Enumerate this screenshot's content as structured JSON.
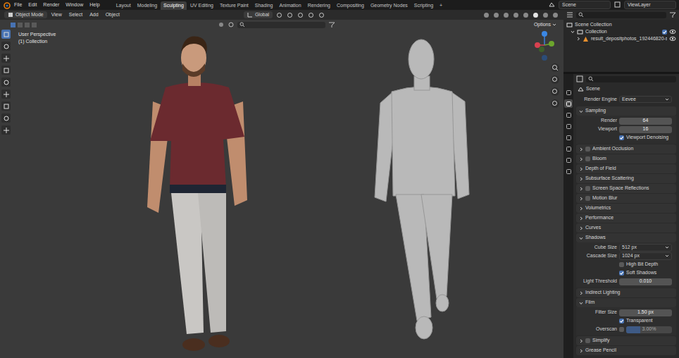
{
  "topbar": {
    "menus": [
      "File",
      "Edit",
      "Render",
      "Window",
      "Help"
    ],
    "workspaces": [
      {
        "label": "Layout",
        "selected": false
      },
      {
        "label": "Modeling",
        "selected": false
      },
      {
        "label": "Sculpting",
        "selected": true
      },
      {
        "label": "UV Editing",
        "selected": false
      },
      {
        "label": "Texture Paint",
        "selected": false
      },
      {
        "label": "Shading",
        "selected": false
      },
      {
        "label": "Animation",
        "selected": false
      },
      {
        "label": "Rendering",
        "selected": false
      },
      {
        "label": "Compositing",
        "selected": false
      },
      {
        "label": "Geometry Nodes",
        "selected": false
      },
      {
        "label": "Scripting",
        "selected": false
      }
    ],
    "add_workspace": "+",
    "scene": "Scene",
    "view_layer": "ViewLayer"
  },
  "header": {
    "mode": "Object Mode",
    "menus": [
      "View",
      "Select",
      "Add",
      "Object"
    ],
    "orientation": "Global",
    "options": "Options"
  },
  "viewport": {
    "view": "User Perspective",
    "collection": "(1) Collection",
    "gizmo": [
      {
        "color": "#3b87e4"
      },
      {
        "color": "#d8414f"
      },
      {
        "color": "#6ca52d"
      },
      {
        "color": "#3f5e2a"
      },
      {
        "color": "#2c4d78"
      }
    ]
  },
  "outliner": {
    "items": [
      {
        "label": "Scene Collection",
        "kind": "root",
        "expanded": true
      },
      {
        "label": "Collection",
        "kind": "collection",
        "expanded": true,
        "checked": true,
        "visible": true
      },
      {
        "label": "result_depositphotos_192446820-s",
        "kind": "object",
        "expanded": false,
        "visible": true
      }
    ]
  },
  "properties": {
    "tabs": [
      {
        "selected": false
      },
      {
        "selected": true
      },
      {
        "selected": false
      },
      {
        "selected": false
      },
      {
        "selected": false
      },
      {
        "selected": false
      },
      {
        "selected": false
      },
      {
        "selected": false
      }
    ],
    "context": "Scene",
    "render_engine": {
      "label": "Render Engine",
      "value": "Eevee"
    },
    "sections": [
      {
        "title": "Sampling",
        "expanded": true,
        "fields": [
          {
            "kind": "number",
            "label": "Render",
            "value": "64"
          },
          {
            "kind": "number",
            "label": "Viewport",
            "value": "16"
          },
          {
            "kind": "check",
            "label": "Viewport Denoising",
            "checked": true
          }
        ]
      },
      {
        "title": "Ambient Occlusion",
        "expanded": false,
        "toggle": false,
        "fields": []
      },
      {
        "title": "Bloom",
        "expanded": false,
        "toggle": false,
        "fields": []
      },
      {
        "title": "Depth of Field",
        "expanded": false,
        "fields": []
      },
      {
        "title": "Subsurface Scattering",
        "expanded": false,
        "fields": []
      },
      {
        "title": "Screen Space Reflections",
        "expanded": false,
        "toggle": false,
        "fields": []
      },
      {
        "title": "Motion Blur",
        "expanded": false,
        "toggle": false,
        "fields": []
      },
      {
        "title": "Volumetrics",
        "expanded": false,
        "fields": []
      },
      {
        "title": "Performance",
        "expanded": false,
        "fields": []
      },
      {
        "title": "Curves",
        "expanded": false,
        "fields": []
      },
      {
        "title": "Shadows",
        "expanded": true,
        "fields": [
          {
            "kind": "dropdown",
            "label": "Cube Size",
            "value": "512 px"
          },
          {
            "kind": "dropdown",
            "label": "Cascade Size",
            "value": "1024 px"
          },
          {
            "kind": "check",
            "label": "High Bit Depth",
            "checked": false
          },
          {
            "kind": "check",
            "label": "Soft Shadows",
            "checked": true
          },
          {
            "kind": "number",
            "label": "Light Threshold",
            "value": "0.010"
          }
        ]
      },
      {
        "title": "Indirect Lighting",
        "expanded": false,
        "fields": []
      },
      {
        "title": "Film",
        "expanded": true,
        "fields": [
          {
            "kind": "number",
            "label": "Filter Size",
            "value": "1.50 px"
          },
          {
            "kind": "check",
            "label": "Transparent",
            "checked": true
          },
          {
            "kind": "toggle-slider",
            "label": "Overscan",
            "checked": false,
            "value": "3.00%",
            "level": 0.3
          }
        ]
      },
      {
        "title": "Simplify",
        "expanded": false,
        "toggle": false,
        "fields": []
      },
      {
        "title": "Grease Pencil",
        "expanded": false,
        "fields": []
      }
    ]
  }
}
